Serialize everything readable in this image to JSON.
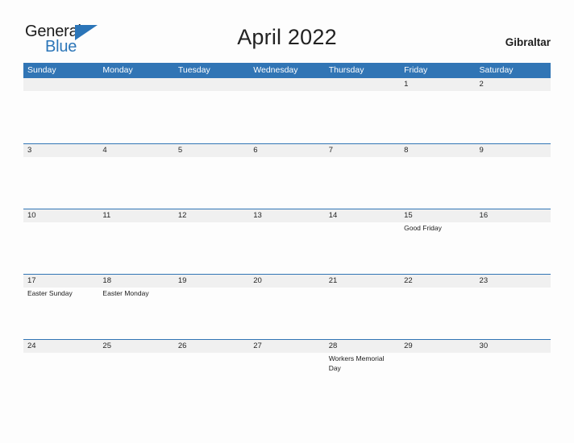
{
  "brand": {
    "name_part1": "General",
    "name_part2": "Blue",
    "triangle_icon": "triangle-right-icon",
    "accent_color": "#2b75b8"
  },
  "header": {
    "title": "April 2022",
    "country": "Gibraltar"
  },
  "colors": {
    "header_blue": "#3175b5",
    "day_band_gray": "#f0f0f0",
    "page_background": "#fdfdfd",
    "text": "#222222"
  },
  "calendar": {
    "weekdays": [
      "Sunday",
      "Monday",
      "Tuesday",
      "Wednesday",
      "Thursday",
      "Friday",
      "Saturday"
    ],
    "weeks": [
      [
        {
          "day": "",
          "event": ""
        },
        {
          "day": "",
          "event": ""
        },
        {
          "day": "",
          "event": ""
        },
        {
          "day": "",
          "event": ""
        },
        {
          "day": "",
          "event": ""
        },
        {
          "day": "1",
          "event": ""
        },
        {
          "day": "2",
          "event": ""
        }
      ],
      [
        {
          "day": "3",
          "event": ""
        },
        {
          "day": "4",
          "event": ""
        },
        {
          "day": "5",
          "event": ""
        },
        {
          "day": "6",
          "event": ""
        },
        {
          "day": "7",
          "event": ""
        },
        {
          "day": "8",
          "event": ""
        },
        {
          "day": "9",
          "event": ""
        }
      ],
      [
        {
          "day": "10",
          "event": ""
        },
        {
          "day": "11",
          "event": ""
        },
        {
          "day": "12",
          "event": ""
        },
        {
          "day": "13",
          "event": ""
        },
        {
          "day": "14",
          "event": ""
        },
        {
          "day": "15",
          "event": "Good Friday"
        },
        {
          "day": "16",
          "event": ""
        }
      ],
      [
        {
          "day": "17",
          "event": "Easter Sunday"
        },
        {
          "day": "18",
          "event": "Easter Monday"
        },
        {
          "day": "19",
          "event": ""
        },
        {
          "day": "20",
          "event": ""
        },
        {
          "day": "21",
          "event": ""
        },
        {
          "day": "22",
          "event": ""
        },
        {
          "day": "23",
          "event": ""
        }
      ],
      [
        {
          "day": "24",
          "event": ""
        },
        {
          "day": "25",
          "event": ""
        },
        {
          "day": "26",
          "event": ""
        },
        {
          "day": "27",
          "event": ""
        },
        {
          "day": "28",
          "event": "Workers Memorial Day"
        },
        {
          "day": "29",
          "event": ""
        },
        {
          "day": "30",
          "event": ""
        }
      ]
    ]
  }
}
